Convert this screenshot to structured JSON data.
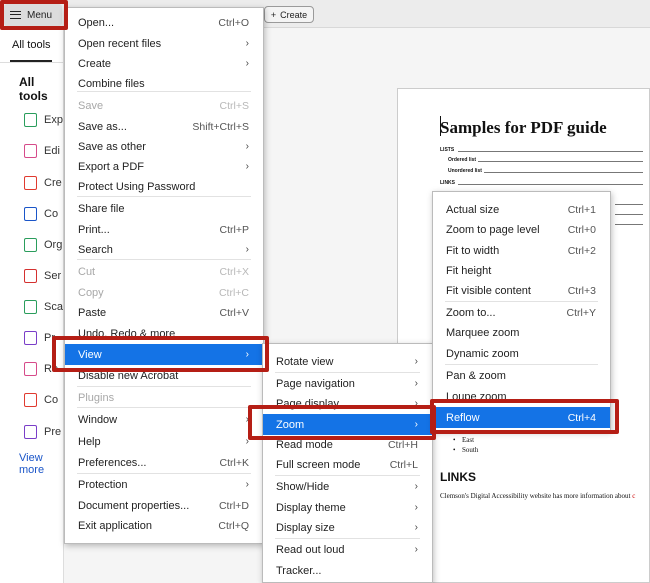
{
  "toolbar": {
    "menu_label": "Menu",
    "create_label": "Create"
  },
  "left_panel": {
    "tab_label": "All tools",
    "heading": "All tools",
    "tools": [
      {
        "label": "Exp",
        "icon": "export-pdf-icon",
        "color": "#2a9d5c"
      },
      {
        "label": "Edi",
        "icon": "edit-pdf-icon",
        "color": "#d64b8a"
      },
      {
        "label": "Cre",
        "icon": "create-pdf-icon",
        "color": "#e03a2f"
      },
      {
        "label": "Co",
        "icon": "combine-files-icon",
        "color": "#1a55c8"
      },
      {
        "label": "Org",
        "icon": "organize-pages-icon",
        "color": "#2a9d5c"
      },
      {
        "label": "Ser",
        "icon": "request-signatures-icon",
        "color": "#d4302f"
      },
      {
        "label": "Sca",
        "icon": "scan-ocr-icon",
        "color": "#2a9d5c"
      },
      {
        "label": "Pr",
        "icon": "protect-icon",
        "color": "#7a3ec8"
      },
      {
        "label": "Re",
        "icon": "redact-icon",
        "color": "#d64b8a"
      },
      {
        "label": "Co",
        "icon": "compress-icon",
        "color": "#e03a2f"
      },
      {
        "label": "Pre",
        "icon": "prepare-form-icon",
        "color": "#7a3ec8"
      }
    ],
    "view_more": "View more"
  },
  "document": {
    "title": "Samples for PDF guide",
    "toc": [
      {
        "label": "LISTS"
      },
      {
        "label": "Ordered list"
      },
      {
        "label": "Unordered list"
      },
      {
        "label": "LINKS"
      }
    ],
    "bullets": [
      "East",
      "South"
    ],
    "links_heading": "LINKS",
    "links_text": "Clemson's Digital Accessibility website has more information about",
    "links_text_link": "c"
  },
  "main_menu": {
    "items": [
      {
        "label": "Open...",
        "shortcut": "Ctrl+O"
      },
      {
        "label": "Open recent files",
        "arrow": "›"
      },
      {
        "label": "Create",
        "arrow": "›"
      },
      {
        "label": "Combine files"
      },
      {
        "label": "Save",
        "shortcut": "Ctrl+S"
      },
      {
        "label": "Save as...",
        "shortcut": "Shift+Ctrl+S"
      },
      {
        "label": "Save as other",
        "arrow": "›"
      },
      {
        "label": "Export a PDF",
        "arrow": "›"
      },
      {
        "label": "Protect Using Password"
      },
      {
        "label": "Share file"
      },
      {
        "label": "Print...",
        "shortcut": "Ctrl+P"
      },
      {
        "label": "Search",
        "arrow": "›"
      },
      {
        "label": "Cut",
        "shortcut": "Ctrl+X"
      },
      {
        "label": "Copy",
        "shortcut": "Ctrl+C"
      },
      {
        "label": "Paste",
        "shortcut": "Ctrl+V"
      },
      {
        "label": "Undo, Redo & more"
      },
      {
        "label": "View",
        "arrow": "›"
      },
      {
        "label": "Disable new Acrobat"
      },
      {
        "label": "Plugins"
      },
      {
        "label": "Window",
        "arrow": "›"
      },
      {
        "label": "Help",
        "arrow": "›"
      },
      {
        "label": "Preferences...",
        "shortcut": "Ctrl+K"
      },
      {
        "label": "Protection",
        "arrow": "›"
      },
      {
        "label": "Document properties...",
        "shortcut": "Ctrl+D"
      },
      {
        "label": "Exit application",
        "shortcut": "Ctrl+Q"
      }
    ]
  },
  "view_menu": {
    "items": [
      {
        "label": "Rotate view",
        "arrow": "›"
      },
      {
        "label": "Page navigation",
        "arrow": "›"
      },
      {
        "label": "Page display",
        "arrow": "›"
      },
      {
        "label": "Zoom",
        "arrow": "›"
      },
      {
        "label": "Read mode",
        "shortcut": "Ctrl+H"
      },
      {
        "label": "Full screen mode",
        "shortcut": "Ctrl+L"
      },
      {
        "label": "Show/Hide",
        "arrow": "›"
      },
      {
        "label": "Display theme",
        "arrow": "›"
      },
      {
        "label": "Display size",
        "arrow": "›"
      },
      {
        "label": "Read out loud",
        "arrow": "›"
      },
      {
        "label": "Tracker..."
      }
    ]
  },
  "zoom_menu": {
    "items": [
      {
        "label": "Actual size",
        "shortcut": "Ctrl+1"
      },
      {
        "label": "Zoom to page level",
        "shortcut": "Ctrl+0"
      },
      {
        "label": "Fit to width",
        "shortcut": "Ctrl+2"
      },
      {
        "label": "Fit height"
      },
      {
        "label": "Fit visible content",
        "shortcut": "Ctrl+3"
      },
      {
        "label": "Zoom to...",
        "shortcut": "Ctrl+Y"
      },
      {
        "label": "Marquee zoom"
      },
      {
        "label": "Dynamic zoom"
      },
      {
        "label": "Pan & zoom"
      },
      {
        "label": "Loupe zoom"
      },
      {
        "label": "Reflow",
        "shortcut": "Ctrl+4"
      }
    ]
  },
  "colors": {
    "accent": "#1473e6",
    "highlight": "#b51e15"
  }
}
